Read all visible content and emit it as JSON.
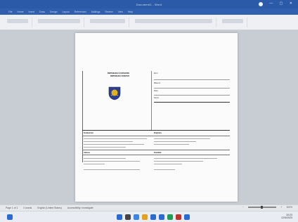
{
  "window": {
    "title": "Document1 - Word",
    "controls": "— ▢ ✕"
  },
  "menu": {
    "items": [
      "File",
      "Home",
      "Insert",
      "Draw",
      "Design",
      "Layout",
      "References",
      "Mailings",
      "Review",
      "View",
      "Help"
    ]
  },
  "document": {
    "org_line1": "REPUBLIKA E KOSOVES",
    "org_line2": "REPUBLIKA KOSOVO",
    "logo_colors": {
      "shield": "#2c3f8f",
      "sun": "#e3b21f"
    },
    "field_labels": [
      "Emri",
      "Mbiemri",
      "Data",
      "Numri"
    ],
    "row_labels": [
      "Institucioni",
      "Drejtoria",
      "Adresa",
      "Kontakti"
    ]
  },
  "status": {
    "page": "Page 1 of 1",
    "words": "0 words",
    "language": "English (United States)",
    "accessibility": "Accessibility: Investigate",
    "zoom": "100%"
  },
  "taskbar": {
    "time": "10:23",
    "date": "12/5/2023",
    "icon_colors": [
      "#2a6ad4",
      "#444444",
      "#3a86e0",
      "#e3a21a",
      "#2a6ad4",
      "#2a6ad4",
      "#1f9d55",
      "#c2312b",
      "#2a6ad4"
    ]
  }
}
